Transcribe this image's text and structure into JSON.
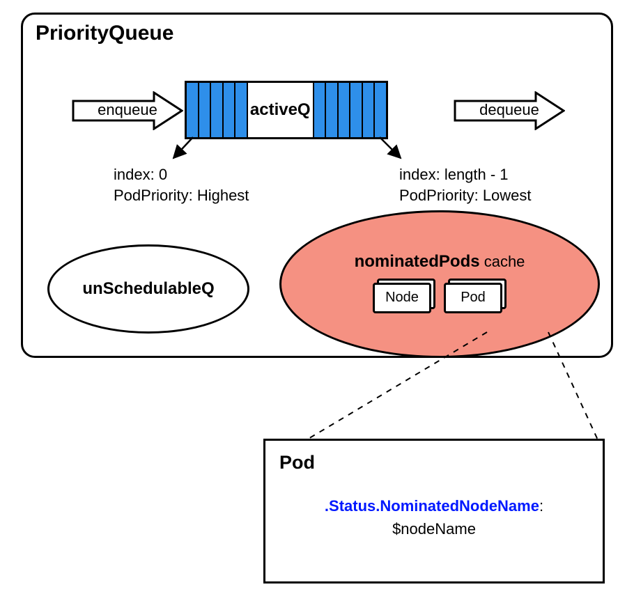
{
  "container": {
    "title": "PriorityQueue"
  },
  "arrows": {
    "enqueue": "enqueue",
    "dequeue": "dequeue"
  },
  "activeQ": {
    "label": "activeQ"
  },
  "annotations": {
    "left": {
      "line1": "index: 0",
      "line2": "PodPriority: Highest"
    },
    "right": {
      "line1": "index: length - 1",
      "line2": "PodPriority: Lowest"
    }
  },
  "unschedulableQ": {
    "label": "unSchedulableQ"
  },
  "nominatedPods": {
    "labelBold": "nominatedPods",
    "labelSuffix": " cache",
    "stackNode": "Node",
    "stackPod": "Pod"
  },
  "podDetail": {
    "title": "Pod",
    "keyLine": ".Status.NominatedNodeName",
    "keySuffix": ":",
    "valueLine": "$nodeName"
  }
}
